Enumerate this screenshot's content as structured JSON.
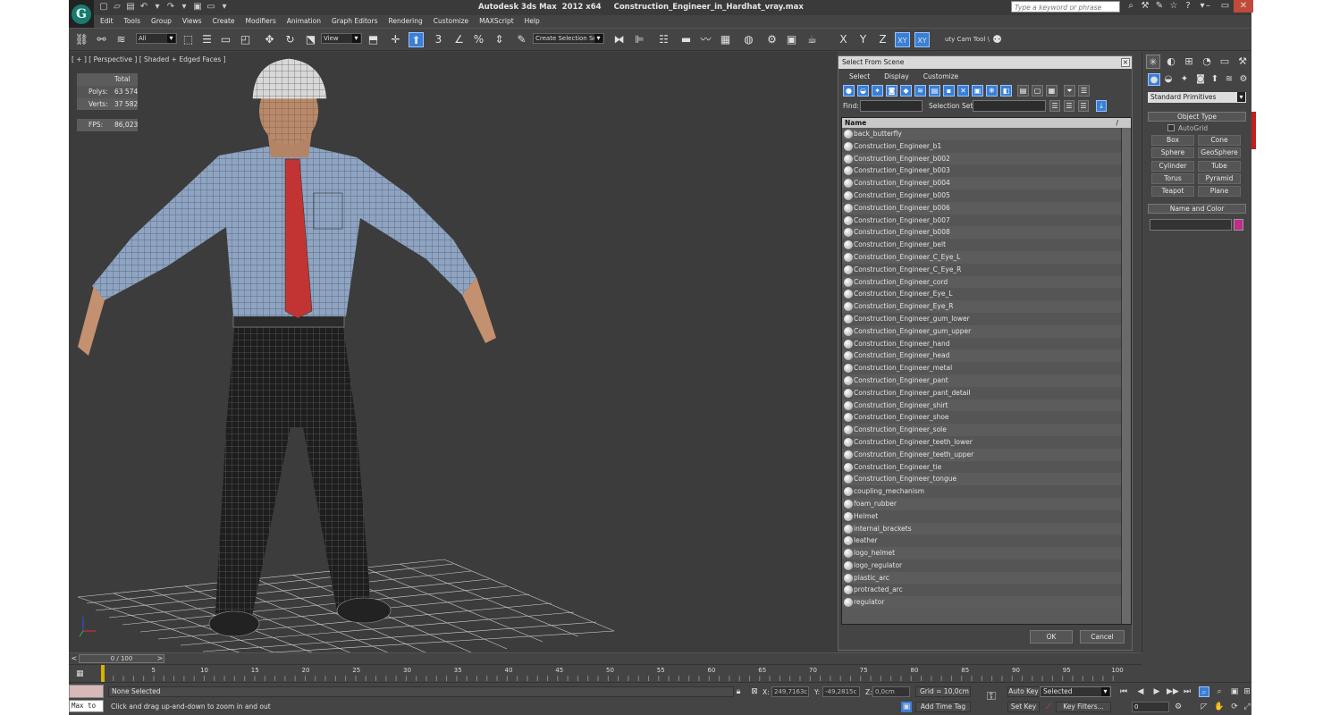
{
  "window": {
    "app_title": "Autodesk 3ds Max  2012 x64",
    "file_name": "Construction_Engineer_in_Hardhat_vray.max",
    "search_placeholder": "Type a keyword or phrase",
    "logo_glyph": "G"
  },
  "menu": [
    "Edit",
    "Tools",
    "Group",
    "Views",
    "Create",
    "Modifiers",
    "Animation",
    "Graph Editors",
    "Rendering",
    "Customize",
    "MAXScript",
    "Help"
  ],
  "toolbar": {
    "filter_value": "All",
    "refcoord_value": "View",
    "snap_label": "3",
    "percent_label": "%",
    "selection_set_value": "Create Selection Se",
    "axis_x": "X",
    "axis_y": "Y",
    "axis_z": "Z",
    "axis_xy": "XY",
    "axis_xy2": "XY",
    "cam_tool_label": "uty Cam Tool \\"
  },
  "viewport": {
    "label": "[ + ] [ Perspective ] [ Shaded + Edged Faces ]",
    "stats_header": "Total",
    "polys_label": "Polys:",
    "polys_value": "63 574",
    "verts_label": "Verts:",
    "verts_value": "37 582",
    "fps_label": "FPS:",
    "fps_value": "86,023"
  },
  "dialog": {
    "title": "Select From Scene",
    "menu": [
      "Select",
      "Display",
      "Customize"
    ],
    "find_label": "Find:",
    "selection_set_label": "Selection Set:",
    "column_name": "Name",
    "column_sort": "/",
    "items": [
      "back_butterfly",
      "Construction_Engineer_b1",
      "Construction_Engineer_b002",
      "Construction_Engineer_b003",
      "Construction_Engineer_b004",
      "Construction_Engineer_b005",
      "Construction_Engineer_b006",
      "Construction_Engineer_b007",
      "Construction_Engineer_b008",
      "Construction_Engineer_belt",
      "Construction_Engineer_C_Eye_L",
      "Construction_Engineer_C_Eye_R",
      "Construction_Engineer_cord",
      "Construction_Engineer_Eye_L",
      "Construction_Engineer_Eye_R",
      "Construction_Engineer_gum_lower",
      "Construction_Engineer_gum_upper",
      "Construction_Engineer_hand",
      "Construction_Engineer_head",
      "Construction_Engineer_metal",
      "Construction_Engineer_pant",
      "Construction_Engineer_pant_detail",
      "Construction_Engineer_shirt",
      "Construction_Engineer_shoe",
      "Construction_Engineer_sole",
      "Construction_Engineer_teeth_lower",
      "Construction_Engineer_teeth_upper",
      "Construction_Engineer_tie",
      "Construction_Engineer_tongue",
      "coupling_mechanism",
      "foam_rubber",
      "Helmet",
      "internal_brackets",
      "leather",
      "logo_helmet",
      "logo_regulator",
      "plastic_arc",
      "protracted_arc",
      "regulator"
    ],
    "ok_label": "OK",
    "cancel_label": "Cancel"
  },
  "command_panel": {
    "category_value": "Standard Primitives",
    "object_type_header": "Object Type",
    "autogrid_label": "AutoGrid",
    "buttons": [
      "Box",
      "Cone",
      "Sphere",
      "GeoSphere",
      "Cylinder",
      "Tube",
      "Torus",
      "Pyramid",
      "Teapot",
      "Plane"
    ],
    "name_color_header": "Name and Color",
    "object_color": "#c12b8a"
  },
  "timeline": {
    "slider_label": "0 / 100",
    "ticks": [
      "0",
      "5",
      "10",
      "15",
      "20",
      "25",
      "30",
      "35",
      "40",
      "45",
      "50",
      "55",
      "60",
      "65",
      "70",
      "75",
      "80",
      "85",
      "90",
      "95",
      "100"
    ]
  },
  "status": {
    "maxscript_label": "Max to",
    "selection_text": "None Selected",
    "prompt_text": "Click and drag up-and-down to zoom in and out",
    "x_label": "X:",
    "x_value": "249,7163c",
    "y_label": "Y:",
    "y_value": "-49,2815c",
    "z_label": "Z:",
    "z_value": "0,0cm",
    "grid_text": "Grid = 10,0cm",
    "add_time_tag": "Add Time Tag",
    "auto_key": "Auto Key",
    "set_key": "Set Key",
    "key_mode_value": "Selected",
    "key_filters": "Key Filters...",
    "frame_value": "0"
  },
  "colors": {
    "accent": "#3a7fd6",
    "ui_bg": "#444444",
    "viewport_bg": "#3c3c3c",
    "stats_text": "#e8d050"
  }
}
